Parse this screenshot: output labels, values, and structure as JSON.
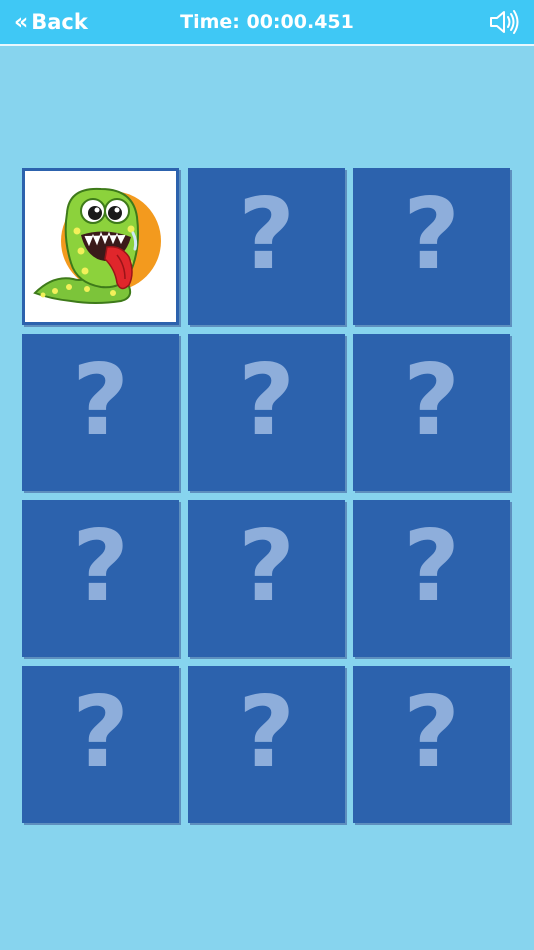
{
  "header": {
    "back_label": "Back",
    "back_chevron": "«",
    "timer_text": "Time: 00:00.451",
    "sound_icon": "speaker-icon"
  },
  "grid": {
    "rows": 4,
    "cols": 3,
    "cards": [
      {
        "state": "revealed",
        "image": "green-monster-tongue"
      },
      {
        "state": "hidden",
        "symbol": "?"
      },
      {
        "state": "hidden",
        "symbol": "?"
      },
      {
        "state": "hidden",
        "symbol": "?"
      },
      {
        "state": "hidden",
        "symbol": "?"
      },
      {
        "state": "hidden",
        "symbol": "?"
      },
      {
        "state": "hidden",
        "symbol": "?"
      },
      {
        "state": "hidden",
        "symbol": "?"
      },
      {
        "state": "hidden",
        "symbol": "?"
      },
      {
        "state": "hidden",
        "symbol": "?"
      },
      {
        "state": "hidden",
        "symbol": "?"
      },
      {
        "state": "hidden",
        "symbol": "?"
      }
    ]
  },
  "colors": {
    "background": "#87d4ee",
    "header": "#3fc8f5",
    "card_back": "#2c62ad",
    "question_mark": "#8eaedb"
  }
}
